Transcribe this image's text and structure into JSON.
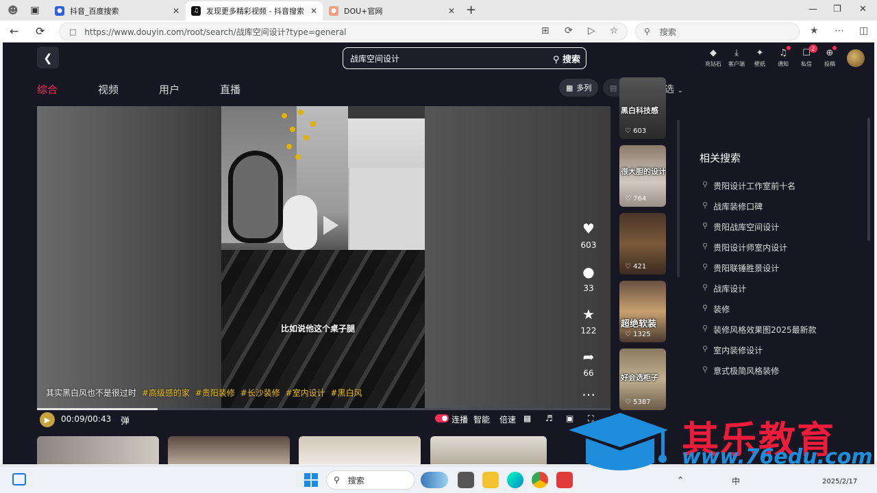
{
  "browser": {
    "tabs": [
      {
        "title": "抖音_百度搜索"
      },
      {
        "title": "发现更多精彩视频 - 抖音搜索"
      },
      {
        "title": "DOU+官网"
      }
    ],
    "url": "https://www.douyin.com/root/search/战库空间设计?type=general",
    "search_placeholder": "搜索"
  },
  "page": {
    "search_query": "战库空间设计",
    "search_button": "搜索",
    "top_icons": [
      {
        "label": "充钻石"
      },
      {
        "label": "客户端"
      },
      {
        "label": "壁纸"
      },
      {
        "label": "通知"
      },
      {
        "label": "私信",
        "badge": "2"
      },
      {
        "label": "投稿"
      }
    ],
    "tabs": [
      "综合",
      "视频",
      "用户",
      "直播"
    ],
    "active_tab": "综合",
    "view_multi": "多列",
    "view_single": "单列",
    "filter": "筛选"
  },
  "video": {
    "subtitle": "比如说他这个桌子腿",
    "caption": "其实黑白风也不是很过时",
    "hashtags": [
      "#高级感的家",
      "#贵阳装修",
      "#长沙装修",
      "#室内设计",
      "#黑白风"
    ],
    "likes": "603",
    "comments": "33",
    "favorites": "122",
    "shares": "66",
    "time": "00:09/00:43",
    "progress": 0.21,
    "danmu": "弹",
    "continuous": "连播",
    "smart": "智能",
    "speed": "倍速"
  },
  "thumbnails": [
    {
      "text": "黑白科技感",
      "likes": "603"
    },
    {
      "text": "很大胆的设计",
      "likes": "764"
    },
    {
      "text": "",
      "likes": "421"
    },
    {
      "text": "超绝软装",
      "likes": "1325"
    },
    {
      "text": "好会选柜子",
      "likes": "5387"
    }
  ],
  "related": {
    "title": "相关搜索",
    "items": [
      "贵阳设计工作室前十名",
      "战库装修口碑",
      "贵阳战库空间设计",
      "贵阳设计师室内设计",
      "贵阳联锤胜景设计",
      "战库设计",
      "装修",
      "装修风格效果图2025最新款",
      "室内装修设计",
      "意式极简风格装修"
    ]
  },
  "watermark": {
    "brand": "其乐教育",
    "url": "www.76edu.com",
    "date": "2025/2/17"
  },
  "taskbar": {
    "search": "搜索",
    "ime": "中"
  },
  "colors": {
    "accent": "#fe2c55",
    "hashtag": "#f5c518",
    "page_bg": "#161722"
  }
}
